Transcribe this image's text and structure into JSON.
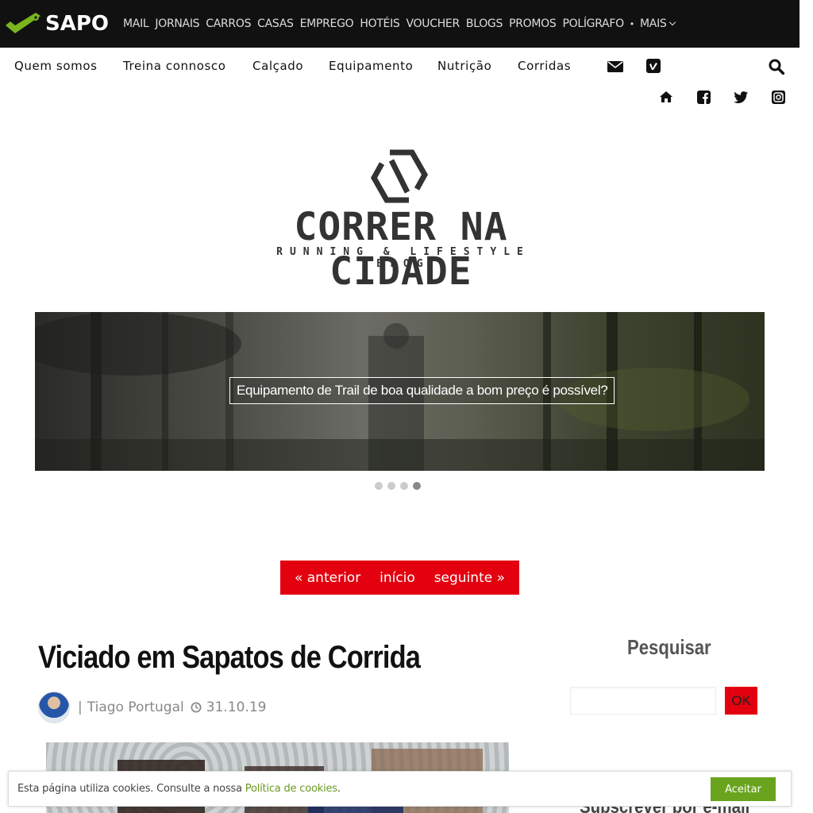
{
  "sapo": {
    "brand": "SAPO",
    "nav": [
      "MAIL",
      "JORNAIS",
      "CARROS",
      "CASAS",
      "EMPREGO",
      "HOTÉIS",
      "VOUCHER",
      "BLOGS",
      "PROMOS",
      "POLÍGRAFO"
    ],
    "more": "MAIS"
  },
  "blog_nav": {
    "items": [
      "Quem somos",
      "Treina connosco",
      "Calçado",
      "Equipamento",
      "Nutrição",
      "Corridas"
    ],
    "icons": [
      "envelope-icon",
      "vimeo-icon",
      "search-icon",
      "home-icon",
      "facebook-icon",
      "twitter-icon",
      "instagram-icon"
    ]
  },
  "logo": {
    "title": "CORRER NA CIDADE",
    "subtitle": "RUNNING & LIFESTYLE BLOG"
  },
  "slider": {
    "caption": "Equipamento de Trail de boa qualidade a bom preço é possível?",
    "dots": 4,
    "active_dot": 3
  },
  "pager": {
    "prev": "« anterior",
    "home": "início",
    "next": "seguinte »"
  },
  "post": {
    "title": "Viciado em Sapatos de Corrida",
    "separator": "|",
    "author": "Tiago Portugal",
    "date": "31.10.19"
  },
  "sidebar": {
    "search_title": "Pesquisar",
    "search_button": "OK",
    "subscribe_title": "Subscrever por e-mail"
  },
  "cookie": {
    "text": "Esta página utiliza cookies. Consulte a nossa ",
    "link": "Política de cookies",
    "suffix": ".",
    "button": "Aceitar"
  },
  "colors": {
    "sapo_bar": "#111111",
    "sapo_green": "#7ab51d",
    "accent_red": "#e3000f",
    "cookie_green": "#6aa31e"
  }
}
